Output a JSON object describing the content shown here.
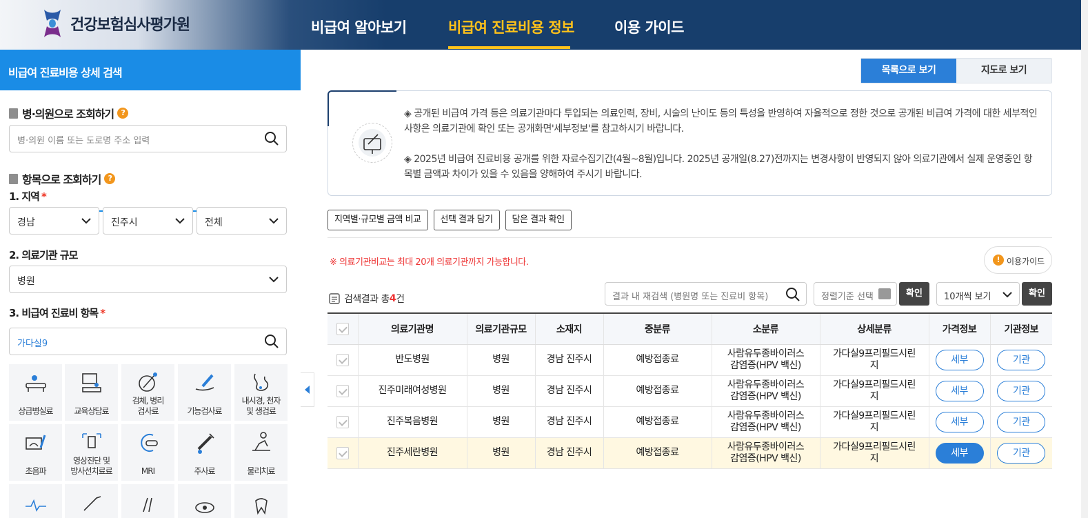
{
  "header": {
    "logo_title": "건강보험심사평가원",
    "nav": [
      {
        "label": "비급여 알아보기",
        "active": false
      },
      {
        "label": "비급여 진료비용 정보",
        "active": true
      },
      {
        "label": "이용 가이드",
        "active": false
      }
    ]
  },
  "sidebar": {
    "title": "비급여 진료비용 상세 검색",
    "hospital_search": {
      "title": "병·의원으로 조회하기",
      "help": "?",
      "placeholder": "병·의원 이름 또는 도로명 주소 입력"
    },
    "item_search": {
      "title": "항목으로 조회하기",
      "help": "?"
    },
    "region": {
      "label": "1. 지역",
      "required": "*",
      "values": [
        "경남",
        "진주시",
        "전체"
      ]
    },
    "scale": {
      "label": "2. 의료기관 규모",
      "value": "병원"
    },
    "item": {
      "label": "3. 비급여 진료비 항목",
      "required": "*",
      "value": "가다실9"
    },
    "categories": [
      {
        "label": "상급병실료",
        "icon": "hospital-bed-icon"
      },
      {
        "label": "교육상담료",
        "icon": "consultation-icon"
      },
      {
        "label": "검체, 병리\n검사료",
        "icon": "pathology-test-icon"
      },
      {
        "label": "기능검사료",
        "icon": "function-test-icon"
      },
      {
        "label": "내시경, 천자\n및 생검료",
        "icon": "endoscope-icon"
      },
      {
        "label": "초음파",
        "icon": "ultrasound-icon"
      },
      {
        "label": "영상진단 및\n방사선치료료",
        "icon": "radiology-icon"
      },
      {
        "label": "MRI",
        "icon": "mri-icon"
      },
      {
        "label": "주사료",
        "icon": "injection-icon"
      },
      {
        "label": "물리치료",
        "icon": "physical-therapy-icon"
      }
    ]
  },
  "view_toggle": {
    "list": "목록으로 보기",
    "map": "지도로 보기"
  },
  "notice": {
    "p1": "◈ 공개된 비급여 가격 등은 의료기관마다 투입되는 의료인력, 장비, 시술의 난이도 등의 특성을 반영하여 자율적으로 정한 것으로 공개된 비급여 가격에 대한 세부적인 사항은 의료기관에 확인 또는 공개화면'세부정보'를 참고하시기 바랍니다.",
    "p2": "◈ 2025년 비급여 진료비용 공개를 위한 자료수집기간(4월~8월)입니다. 2025년 공개일(8.27)전까지는 변경사항이 반영되지 않아 의료기관에서 실제 운영중인 항목별 금액과 차이가 있을 수 있음을 양해하여 주시기 바랍니다."
  },
  "actions": {
    "compare": "지역별·규모별 금액 비교",
    "select": "선택 결과 담기",
    "check": "담은 결과 확인"
  },
  "warning": "※ 의료기관비교는 최대 20개 의료기관까지 가능합니다.",
  "guide_button": {
    "icon": "!",
    "label": "이용가이드"
  },
  "results": {
    "prefix": "검색결과 총",
    "count": "4",
    "suffix": "건",
    "search_placeholder": "결과 내 재검색 (병원명 또는 진료비 항목)",
    "sort_placeholder": "정렬기준 선택",
    "confirm": "확인",
    "per_page": "10개씩 보기",
    "confirm2": "확인"
  },
  "table": {
    "headers": [
      "의료기관명",
      "의료기관규모",
      "소재지",
      "중분류",
      "소분류",
      "상세분류",
      "가격정보",
      "기관정보"
    ],
    "rows": [
      {
        "name": "반도병원",
        "scale": "병원",
        "location": "경남 진주시",
        "mid": "예방접종료",
        "small1": "사람유두종바이러스",
        "small2": "감염증(HPV 백신)",
        "detail1": "가다실9프리필드시린",
        "detail2": "지",
        "price_btn": "세부",
        "org_btn": "기관",
        "highlight": false
      },
      {
        "name": "진주미래여성병원",
        "scale": "병원",
        "location": "경남 진주시",
        "mid": "예방접종료",
        "small1": "사람유두종바이러스",
        "small2": "감염증(HPV 백신)",
        "detail1": "가다실9프리필드시린",
        "detail2": "지",
        "price_btn": "세부",
        "org_btn": "기관",
        "highlight": false
      },
      {
        "name": "진주복음병원",
        "scale": "병원",
        "location": "경남 진주시",
        "mid": "예방접종료",
        "small1": "사람유두종바이러스",
        "small2": "감염증(HPV 백신)",
        "detail1": "가다실9프리필드시린",
        "detail2": "지",
        "price_btn": "세부",
        "org_btn": "기관",
        "highlight": false
      },
      {
        "name": "진주세란병원",
        "scale": "병원",
        "location": "경남 진주시",
        "mid": "예방접종료",
        "small1": "사람유두종바이러스",
        "small2": "감염증(HPV 백신)",
        "detail1": "가다실9프리필드시린",
        "detail2": "지",
        "price_btn": "세부",
        "org_btn": "기관",
        "highlight": true
      }
    ]
  },
  "colors": {
    "primary": "#2b7fd8",
    "header_dark": "#173e6c",
    "accent_yellow": "#ffc21a",
    "help_orange": "#f2961c",
    "warning_red": "#e33333",
    "highlight_row": "#fff8e1"
  }
}
